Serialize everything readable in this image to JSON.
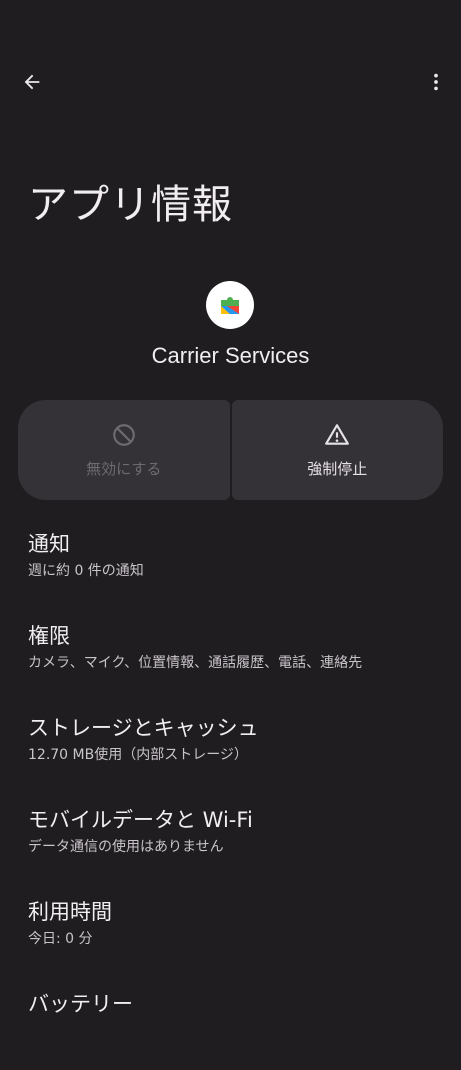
{
  "header": {
    "back_icon": "arrow-left-icon",
    "more_icon": "more-vert-icon"
  },
  "page": {
    "title": "アプリ情報"
  },
  "app": {
    "name": "Carrier Services",
    "icon": "carrier-services-puzzle-icon"
  },
  "actions": {
    "disable": {
      "label": "無効にする",
      "icon": "block-icon",
      "enabled": false
    },
    "force_stop": {
      "label": "強制停止",
      "icon": "warning-icon",
      "enabled": true
    }
  },
  "settings": [
    {
      "title": "通知",
      "summary": "週に約 0 件の通知"
    },
    {
      "title": "権限",
      "summary": "カメラ、マイク、位置情報、通話履歴、電話、連絡先"
    },
    {
      "title": "ストレージとキャッシュ",
      "summary": "12.70 MB使用（内部ストレージ）"
    },
    {
      "title": "モバイルデータと Wi-Fi",
      "summary": "データ通信の使用はありません"
    },
    {
      "title": "利用時間",
      "summary": "今日: 0 分"
    },
    {
      "title": "バッテリー",
      "summary": ""
    }
  ],
  "colors": {
    "background": "#1f1d20",
    "button_surface": "#353237",
    "text_primary": "#f1edf1",
    "text_secondary": "#c9c4ca",
    "text_disabled": "#6e6a70"
  }
}
